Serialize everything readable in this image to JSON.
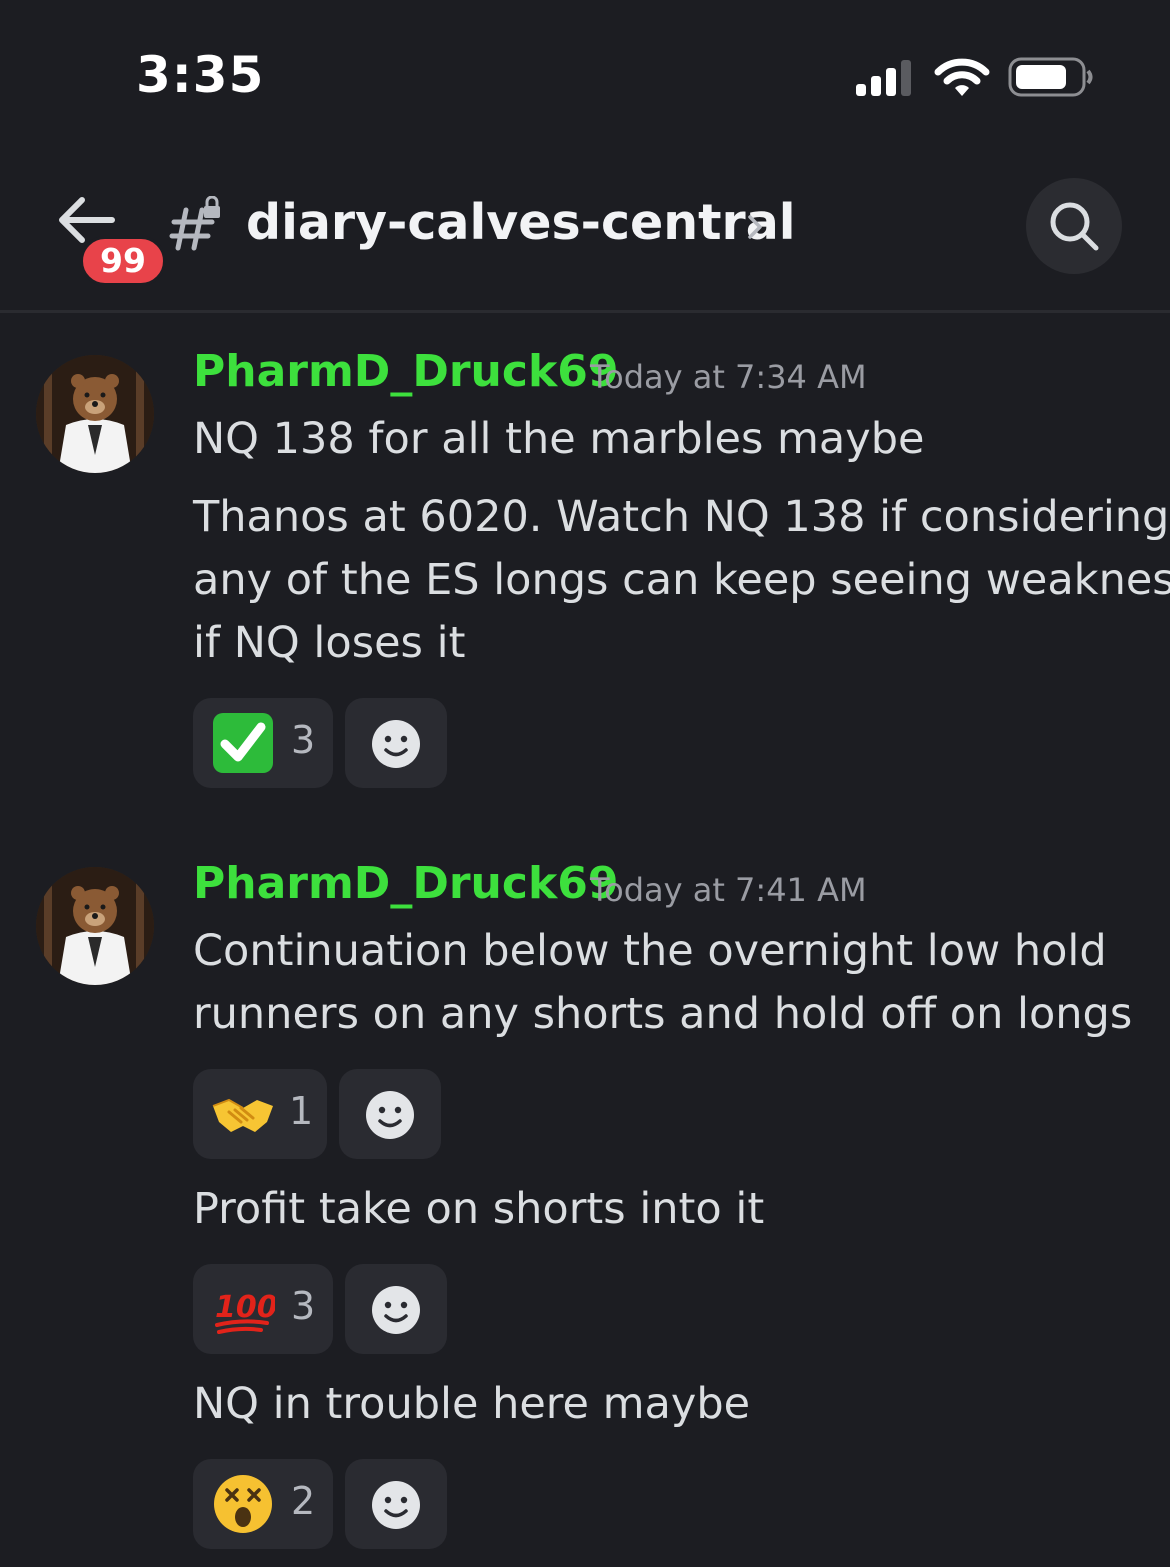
{
  "status_bar": {
    "time": "3:35"
  },
  "header": {
    "badge_count": "99",
    "channel_name": "diary-calves-central"
  },
  "messages": [
    {
      "username": "PharmD_Druck69",
      "timestamp": "Today at 7:34 AM",
      "lines": [
        "NQ 138 for all the marbles maybe",
        "Thanos at 6020. Watch NQ 138 if considering",
        "any of the ES longs can keep seeing weakness",
        "if NQ loses it"
      ],
      "reactions": [
        {
          "emoji": "check-mark-emoji",
          "count": "3"
        }
      ]
    },
    {
      "username": "PharmD_Druck69",
      "timestamp": "Today at 7:41 AM",
      "lines": [
        "Continuation below the overnight low hold",
        "runners on any shorts and hold off on longs"
      ],
      "reactions": [
        {
          "emoji": "handshake-emoji",
          "count": "1"
        }
      ]
    },
    {
      "text": "Profit take on shorts into it",
      "reactions": [
        {
          "emoji": "hundred-points-emoji",
          "count": "3"
        }
      ]
    },
    {
      "text": "NQ in trouble here maybe",
      "reactions": [
        {
          "emoji": "dizzy-face-emoji",
          "count": "2"
        }
      ]
    }
  ],
  "colors": {
    "background": "#1c1d22",
    "username": "#3de03d",
    "badge": "#e8434a",
    "reaction_bg": "#2a2b31"
  }
}
